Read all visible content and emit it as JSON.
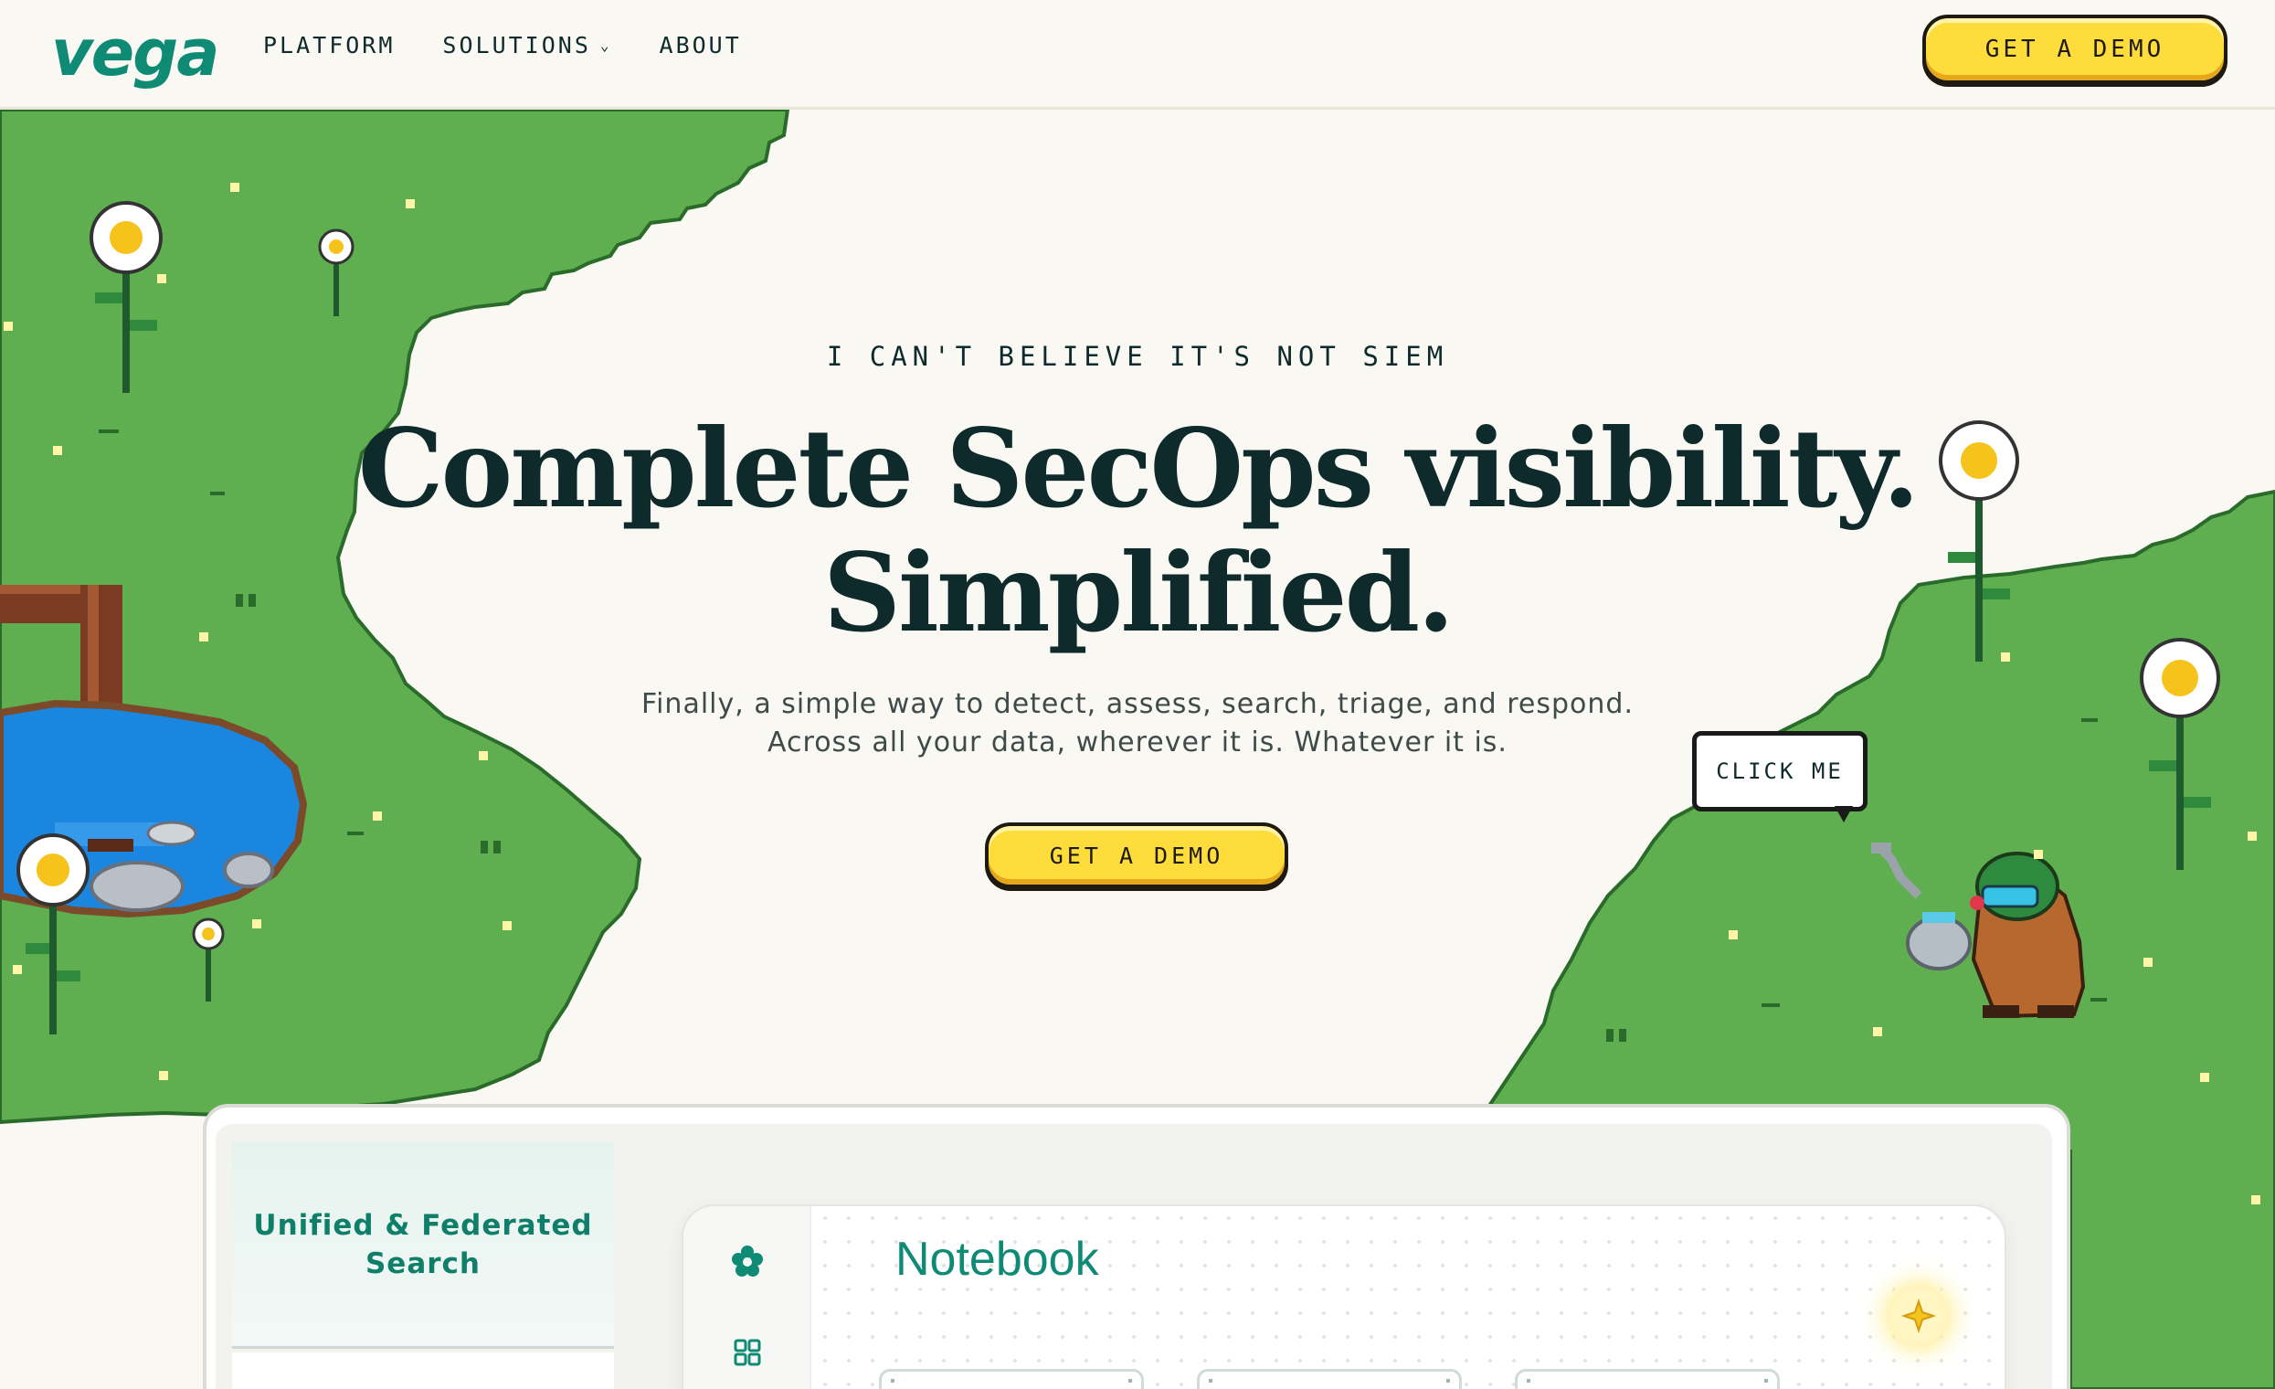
{
  "header": {
    "logo": "vega",
    "nav": [
      {
        "label": "PLATFORM"
      },
      {
        "label": "SOLUTIONS",
        "has_dropdown": true
      },
      {
        "label": "ABOUT"
      }
    ],
    "cta_label": "GET A DEMO"
  },
  "hero": {
    "eyebrow": "I CAN'T BELIEVE IT'S NOT SIEM",
    "title_line1": "Complete SecOps visibility.",
    "title_line2": "Simplified.",
    "subtitle_line1": "Finally, a simple way to detect, assess, search, triage, and respond.",
    "subtitle_line2": "Across all your data, wherever it is. Whatever it is.",
    "cta_label": "GET A DEMO"
  },
  "mascot": {
    "bubble_label": "CLICK ME"
  },
  "product_panel": {
    "active_tab": "Unified & Federated Search",
    "app": {
      "title": "Notebook",
      "rail_icons": [
        "flower-icon",
        "grid-icon"
      ],
      "card_count": 3
    }
  },
  "colors": {
    "background": "#f9f8f3",
    "grass": "#5fae4f",
    "brand_teal": "#0f8a75",
    "cta_yellow": "#fddc3c",
    "water": "#1a86e0",
    "text_dark": "#0e2a2a"
  }
}
